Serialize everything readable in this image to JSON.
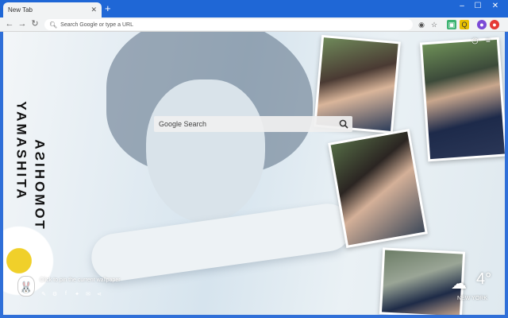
{
  "browser": {
    "tab_title": "New Tab",
    "tab_close": "✕",
    "new_tab": "+",
    "window_controls": [
      "–",
      "☐",
      "✕"
    ],
    "omnibox_placeholder": "Search Google or type a URL"
  },
  "wallpaper": {
    "vertical_text_1": "YAMASHITA",
    "vertical_text_2": "TOMOHISA"
  },
  "search": {
    "placeholder": "Google Search"
  },
  "footer": {
    "caption": "Click to pin the current wallpaper"
  },
  "weather": {
    "temperature": "4°",
    "city": "NEW YORK"
  },
  "colors": {
    "chrome_blue": "#1f67d6",
    "toolbar_gray": "#f1f3f4"
  }
}
